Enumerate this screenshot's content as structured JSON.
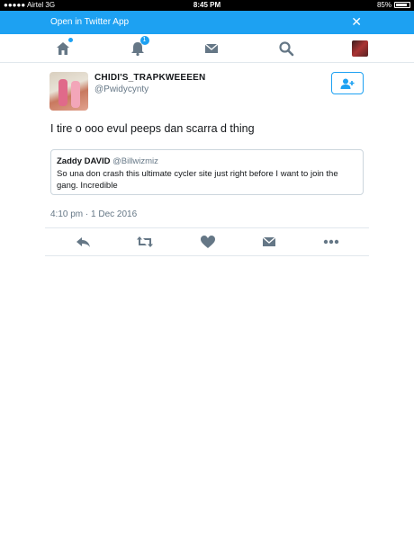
{
  "status_bar": {
    "carrier": "●●●●● Airtel  3G",
    "time": "8:45 PM",
    "battery_text": "85%",
    "battery_level": 0.85
  },
  "open_app": {
    "label": "Open in Twitter App",
    "close_symbol": "✕"
  },
  "nav": {
    "notifications_count": "1"
  },
  "tweet": {
    "author_name": "CHIDI'S_TRAPKWEEEEN",
    "author_handle": "@Pwidycynty",
    "text": "I tire o ooo evul peeps dan scarra d thing",
    "quote": {
      "name": "Zaddy DAVID",
      "handle": "@Billwizmiz",
      "text": "So una don crash this ultimate cycler site just right before I want to join the gang. Incredible"
    },
    "timestamp": "4:10 pm · 1 Dec 2016"
  },
  "colors": {
    "accent": "#1da1f2",
    "icon_gray": "#657786",
    "border": "#e1e8ed"
  }
}
